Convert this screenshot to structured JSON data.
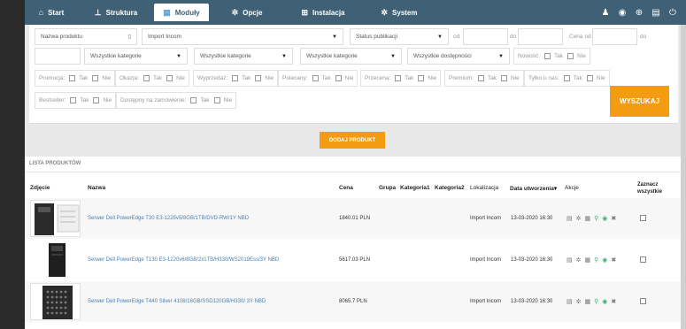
{
  "nav": {
    "tabs": [
      {
        "label": "Start",
        "icon": "home-icon"
      },
      {
        "label": "Struktura",
        "icon": "sitemap-icon"
      },
      {
        "label": "Moduły",
        "icon": "modules-icon"
      },
      {
        "label": "Opcje",
        "icon": "gear-icon"
      },
      {
        "label": "Instalacja",
        "icon": "plus-square-icon"
      },
      {
        "label": "System",
        "icon": "gear-icon"
      }
    ],
    "active_index": 2,
    "right_icons": [
      "user-icon",
      "eye-icon",
      "lifebuoy-icon",
      "printer-icon",
      "power-icon"
    ]
  },
  "filters": {
    "product_name_placeholder": "Nazwa produktu",
    "import_select": "Import Incom",
    "status_select": "Status publikacji",
    "od_label": "od",
    "do_label": "do",
    "price_from_label": "Cena od",
    "price_to_label": "do",
    "category_select_1": "Wszystkie kategorie",
    "category_select_2": "Wszystkie kategorie",
    "category_select_3": "Wszystkie kategorie",
    "availability_select": "Wszystkie dostępności",
    "yes": "Tak",
    "no": "Nie",
    "flags": {
      "new": "Nowość:",
      "promo": "Promocja:",
      "okazja": "Okazja:",
      "wyprzedaz": "Wyprzedaż:",
      "polecany": "Polecany:",
      "przecena": "Przecena:",
      "premium": "Premium:",
      "tylko_u_nas": "Tylko u nas:",
      "bestseller": "Bestseller:",
      "na_zamowienie": "Dostępny na zamówienie:"
    },
    "search_button": "WYSZUKAJ"
  },
  "add_button": "DODAJ PRODUKT",
  "list": {
    "title": "LISTA PRODUKTÓW",
    "headers": {
      "image": "Zdjęcie",
      "name": "Nazwa",
      "price": "Cena",
      "group": "Grupa",
      "cat1": "Kategoria1",
      "cat2": "Kategoria2",
      "location": "Lokalizacja",
      "created": "Data utworzenia▾",
      "actions": "Akcje",
      "select_all_1": "Zaznacz",
      "select_all_2": "wszystkie"
    },
    "rows": [
      {
        "name": "Serwer Dell PowerEdge T30 E3-1225v5/8GB/1TB/DVD-RW/1Y NBD",
        "price": "1840.01 PLN",
        "location": "Import Incom",
        "date": "13-03-2020 16:30"
      },
      {
        "name": "Serwer Dell PowerEdge T130 E3-1220v6/8GB/2x1TB/H330/WS2019Ess/3Y NBD",
        "price": "5617.03 PLN",
        "location": "Import Incom",
        "date": "13-03-2020 16:30"
      },
      {
        "name": "Serwer Dell PowerEdge T440 Silver 4108/16GB/SSD120GB/H330/ 3Y NBD",
        "price": "8065.7 PLN",
        "location": "Import Incom",
        "date": "13-03-2020 16:30"
      }
    ]
  },
  "colors": {
    "nav": "#3f6075",
    "accent": "#f39c12",
    "link": "#4a7fb4",
    "green": "#3cb371"
  }
}
